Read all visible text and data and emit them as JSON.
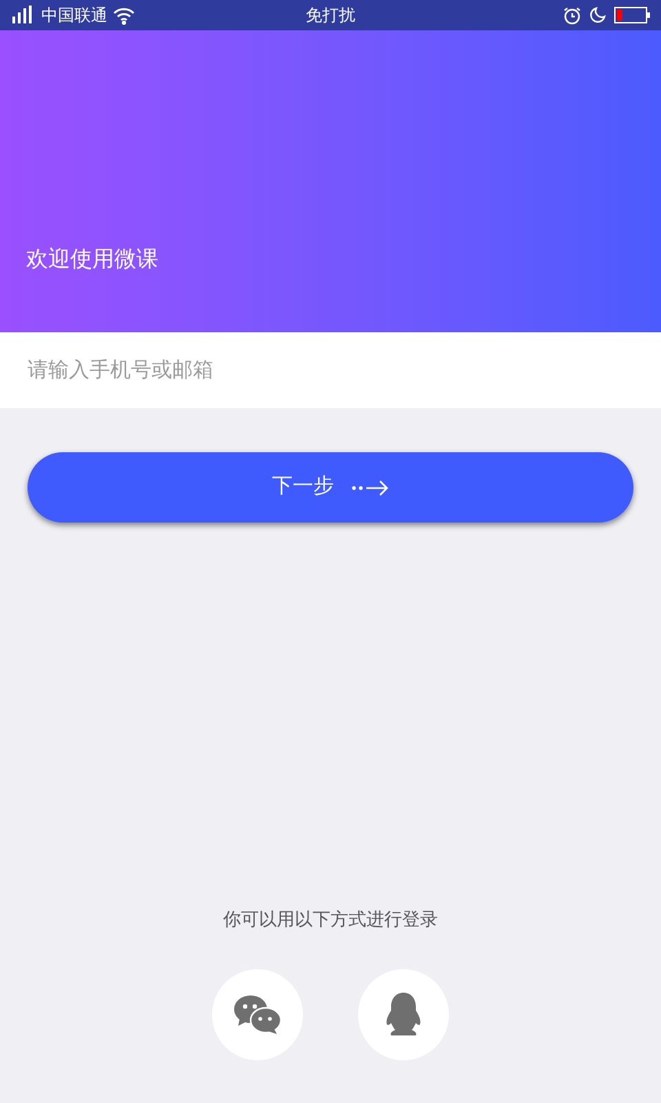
{
  "status_bar": {
    "carrier": "中国联通",
    "mode": "免打扰"
  },
  "header": {
    "title": "欢迎使用微课"
  },
  "account_field": {
    "placeholder": "请输入手机号或邮箱"
  },
  "next_button": {
    "label": "下一步"
  },
  "alt_login": {
    "hint": "你可以用以下方式进行登录",
    "options": [
      {
        "kind": "wechat"
      },
      {
        "kind": "qq"
      }
    ]
  }
}
